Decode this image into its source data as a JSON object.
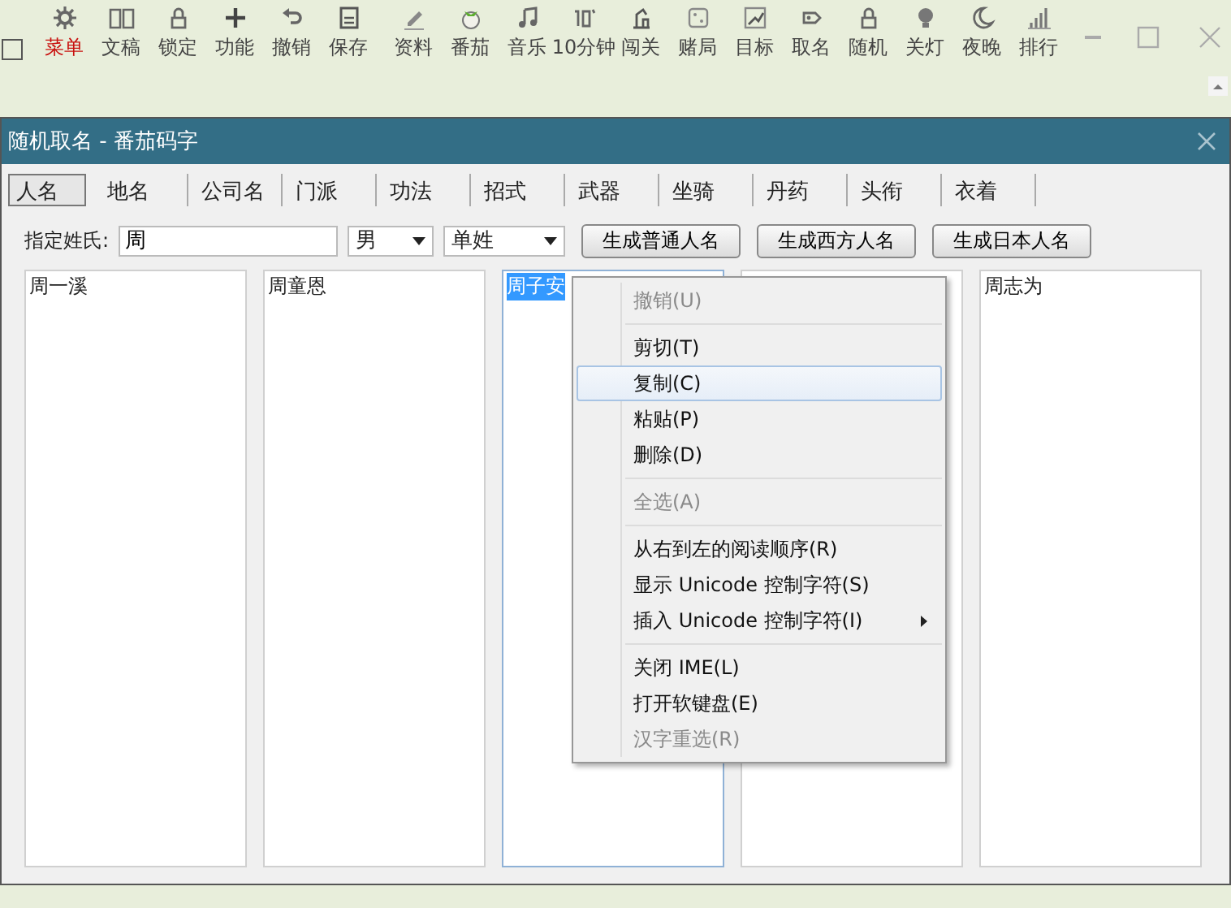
{
  "toolbar": {
    "items": [
      {
        "label": "菜单",
        "selected": true
      },
      {
        "label": "文稿",
        "selected": false
      },
      {
        "label": "锁定",
        "selected": false
      },
      {
        "label": "功能",
        "selected": false
      },
      {
        "label": "撤销",
        "selected": false
      },
      {
        "label": "保存",
        "selected": false
      },
      {
        "label": "资料",
        "selected": false
      },
      {
        "label": "番茄",
        "selected": false
      },
      {
        "label": "音乐",
        "selected": false
      },
      {
        "label": "10分钟",
        "selected": false
      },
      {
        "label": "闯关",
        "selected": false
      },
      {
        "label": "赌局",
        "selected": false
      },
      {
        "label": "目标",
        "selected": false
      },
      {
        "label": "取名",
        "selected": false
      },
      {
        "label": "随机",
        "selected": false
      },
      {
        "label": "关灯",
        "selected": false
      },
      {
        "label": "夜晚",
        "selected": false
      },
      {
        "label": "排行",
        "selected": false
      }
    ]
  },
  "dialog": {
    "title": "随机取名 - 番茄码字",
    "tabs": [
      {
        "label": "人名",
        "selected": true
      },
      {
        "label": "地名",
        "selected": false
      },
      {
        "label": "公司名",
        "selected": false
      },
      {
        "label": "门派",
        "selected": false
      },
      {
        "label": "功法",
        "selected": false
      },
      {
        "label": "招式",
        "selected": false
      },
      {
        "label": "武器",
        "selected": false
      },
      {
        "label": "坐骑",
        "selected": false
      },
      {
        "label": "丹药",
        "selected": false
      },
      {
        "label": "头衔",
        "selected": false
      },
      {
        "label": "衣着",
        "selected": false
      }
    ],
    "surname_label": "指定姓氏:",
    "surname_value": "周",
    "gender": "男",
    "surname_type": "单姓",
    "buttons": [
      "生成普通人名",
      "生成西方人名",
      "生成日本人名"
    ],
    "columns": [
      {
        "text": "周一溪",
        "selected": false
      },
      {
        "text": "周童恩",
        "selected": false
      },
      {
        "text": "周子安",
        "selected": true
      },
      {
        "selected": false
      },
      {
        "text": "周志为",
        "selected": false
      }
    ]
  },
  "context_menu": {
    "items": [
      {
        "kind": "item",
        "label": "撤销(U)",
        "disabled": true,
        "highlighted": false,
        "submenu": false
      },
      {
        "kind": "separator"
      },
      {
        "kind": "item",
        "label": "剪切(T)",
        "disabled": false,
        "highlighted": false,
        "submenu": false
      },
      {
        "kind": "item",
        "label": "复制(C)",
        "disabled": false,
        "highlighted": true,
        "submenu": false
      },
      {
        "kind": "item",
        "label": "粘贴(P)",
        "disabled": false,
        "highlighted": false,
        "submenu": false
      },
      {
        "kind": "item",
        "label": "删除(D)",
        "disabled": false,
        "highlighted": false,
        "submenu": false
      },
      {
        "kind": "separator"
      },
      {
        "kind": "item",
        "label": "全选(A)",
        "disabled": true,
        "highlighted": false,
        "submenu": false
      },
      {
        "kind": "separator"
      },
      {
        "kind": "item",
        "label": "从右到左的阅读顺序(R)",
        "disabled": false,
        "highlighted": false,
        "submenu": false
      },
      {
        "kind": "item",
        "label": "显示 Unicode 控制字符(S)",
        "disabled": false,
        "highlighted": false,
        "submenu": false
      },
      {
        "kind": "item",
        "label": "插入 Unicode 控制字符(I)",
        "disabled": false,
        "highlighted": false,
        "submenu": true
      },
      {
        "kind": "separator"
      },
      {
        "kind": "item",
        "label": "关闭 IME(L)",
        "disabled": false,
        "highlighted": false,
        "submenu": false
      },
      {
        "kind": "item",
        "label": "打开软键盘(E)",
        "disabled": false,
        "highlighted": false,
        "submenu": false
      },
      {
        "kind": "item",
        "label": "汉字重选(R)",
        "disabled": true,
        "highlighted": false,
        "submenu": false
      }
    ]
  }
}
